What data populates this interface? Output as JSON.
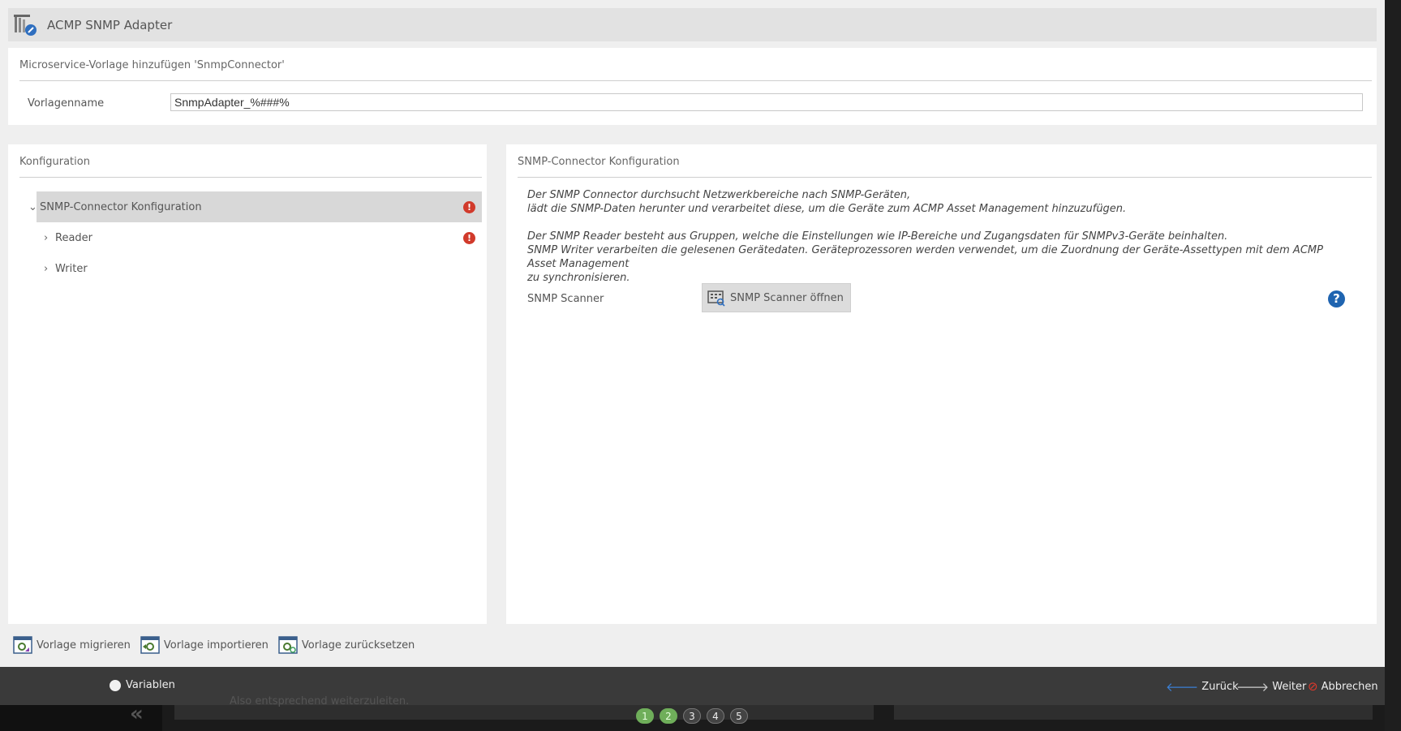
{
  "window": {
    "title": "ACMP SNMP Adapter",
    "app_icon": "acmp-snmp-adapter-icon"
  },
  "template_panel": {
    "header": "Microservice-Vorlage hinzufügen 'SnmpConnector'",
    "name_label": "Vorlagenname",
    "name_value": "SnmpAdapter_%###%"
  },
  "config_panel": {
    "header": "Konfiguration",
    "tree": [
      {
        "label": "SNMP-Connector Konfiguration",
        "expanded": true,
        "selected": true,
        "error": true
      },
      {
        "label": "Reader",
        "expanded": false,
        "selected": false,
        "error": true
      },
      {
        "label": "Writer",
        "expanded": false,
        "selected": false,
        "error": false
      }
    ],
    "error_mark": "!"
  },
  "detail_panel": {
    "header": "SNMP-Connector Konfiguration",
    "desc1_line1": "Der SNMP Connector durchsucht Netzwerkbereiche nach SNMP-Geräten,",
    "desc1_line2": "lädt die SNMP-Daten herunter und verarbeitet diese, um die Geräte zum ACMP Asset Management hinzuzufügen.",
    "desc2_line1": "Der SNMP Reader besteht aus Gruppen, welche die Einstellungen wie IP-Bereiche und Zugangsdaten für SNMPv3-Geräte beinhalten.",
    "desc2_line2": "SNMP Writer verarbeiten die gelesenen Gerätedaten. Geräteprozessoren werden verwendet, um die Zuordnung der Geräte-Assettypen mit dem ACMP Asset Management",
    "desc2_line3": "zu synchronisieren.",
    "scanner_label": "SNMP Scanner",
    "scanner_button": "SNMP Scanner öffnen",
    "help": "?"
  },
  "actions": {
    "migrate": "Vorlage migrieren",
    "import": "Vorlage importieren",
    "reset": "Vorlage zurücksetzen"
  },
  "footer": {
    "variables": "Variablen",
    "back": "Zurück",
    "next": "Weiter",
    "cancel": "Abbrechen"
  },
  "background": {
    "partial_text": "Also entsprechend weiterzuleiten.",
    "steps": [
      "1",
      "2",
      "3",
      "4",
      "5"
    ],
    "steps_done": 2
  },
  "colors": {
    "error": "#d13a2b",
    "help": "#1f64b0",
    "step_done": "#6fae5a",
    "cancel": "#e0392b",
    "back_arrow": "#3b7fd4"
  }
}
